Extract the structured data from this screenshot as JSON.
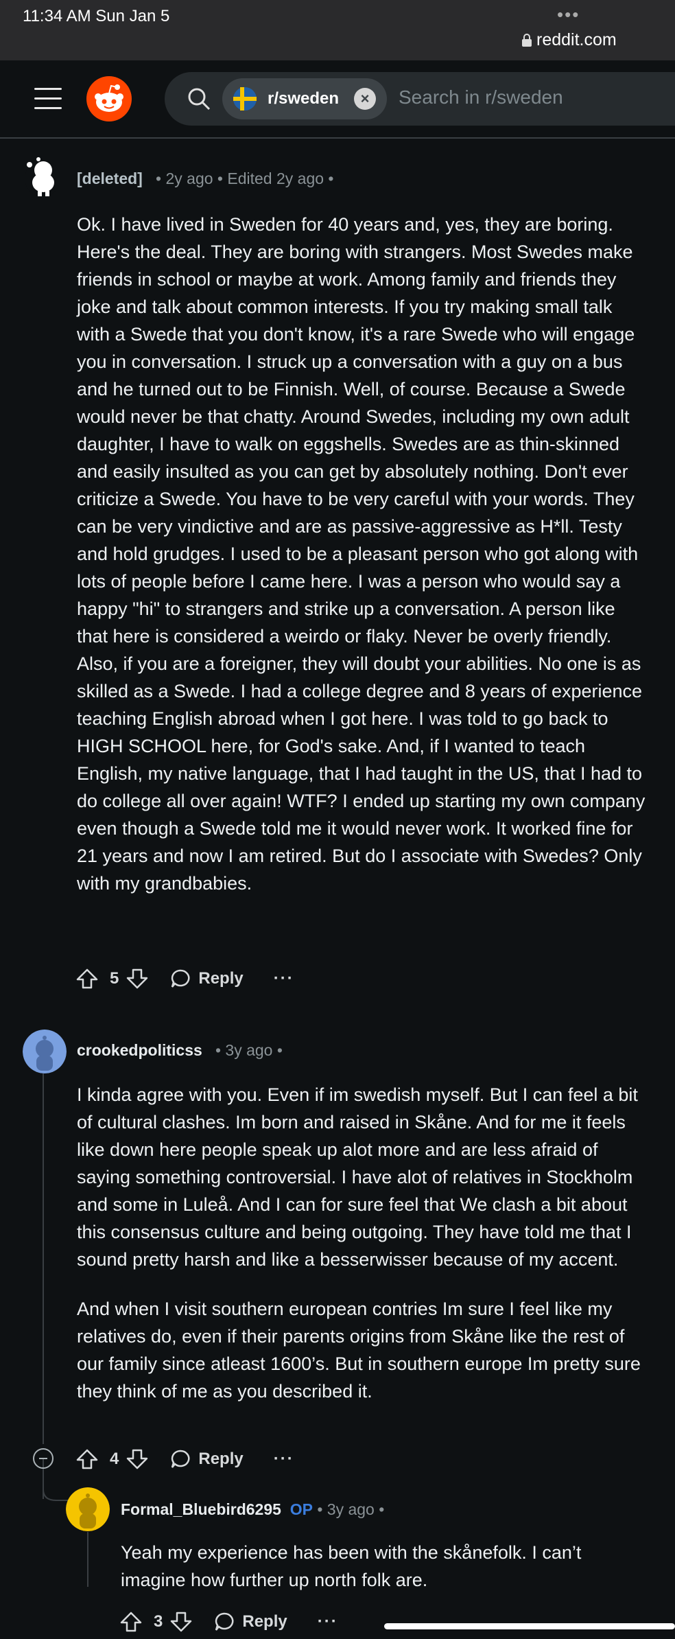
{
  "status": {
    "time": "11:34 AM   Sun Jan 5",
    "dots": "•••",
    "url": "reddit.com"
  },
  "header": {
    "subreddit": "r/sweden",
    "search_placeholder": "Search in r/sweden"
  },
  "comments": [
    {
      "author": "[deleted]",
      "time": "2y ago",
      "edited": "Edited 2y ago",
      "body": [
        "Ok. I have lived in Sweden for 40 years and, yes, they are boring. Here's the deal. They are boring with strangers. Most Swedes make friends in school or maybe at work. Among family and friends they joke and talk about common interests. If you try making small talk with a Swede that you don't know, it's a rare Swede who will engage you in conversation. I struck up a conversation with a guy on a bus and he turned out to be Finnish. Well, of course. Because a Swede would never be that chatty. Around Swedes, including my own adult daughter, I have to walk on eggshells. Swedes are as thin-skinned and easily insulted as you can get by absolutely nothing. Don't ever criticize a Swede. You have to be very careful with your words. They can be very vindictive and are as passive-aggressive as H*ll. Testy and hold grudges. I used to be a pleasant person who got along with lots of people before I came here. I was a person who would say a happy \"hi\" to strangers and strike up a conversation. A person like that here is considered a weirdo or flaky. Never be overly friendly. Also, if you are a foreigner, they will doubt your abilities. No one is as skilled as a Swede. I had a college degree and 8 years of experience teaching English abroad when I got here. I was told to go back to HIGH SCHOOL here, for God's sake. And, if I wanted to teach English, my native language, that I had taught in the US, that I had to do college all over again! WTF? I ended up starting my own company even though a Swede told me it would never work. It worked fine for 21 years and now I am retired. But do I associate with Swedes? Only with my grandbabies."
      ],
      "score": "5",
      "reply_label": "Reply",
      "more": "···"
    },
    {
      "author": "crookedpoliticss",
      "time": "3y ago",
      "body": [
        "I kinda agree with you. Even if im swedish myself. But I can feel a bit of cultural clashes. Im born and raised in Skåne. And for me it feels like down here people speak up alot more and are less afraid of saying something controversial. I have alot of relatives in Stockholm and some in Luleå. And I can for sure feel that We clash a bit about this consensus culture and being outgoing. They have told me that I sound pretty harsh and like a besserwisser because of my accent.",
        "And when I visit southern european contries Im sure I feel like my relatives do, even if their parents origins from Skåne like the rest of our family since atleast 1600’s. But in southern europe Im pretty sure they think of me as you described it."
      ],
      "score": "4",
      "reply_label": "Reply",
      "more": "···"
    },
    {
      "author": "Formal_Bluebird6295",
      "op_badge": "OP",
      "time": "3y ago",
      "body": [
        "Yeah my experience has been with the skånefolk. I can’t imagine how further up north folk are."
      ],
      "score": "3",
      "reply_label": "Reply",
      "more": "···"
    }
  ],
  "colors": {
    "background": "#0e1113",
    "op_badge": "#3b7ddd",
    "reddit_orange": "#ff4500"
  }
}
